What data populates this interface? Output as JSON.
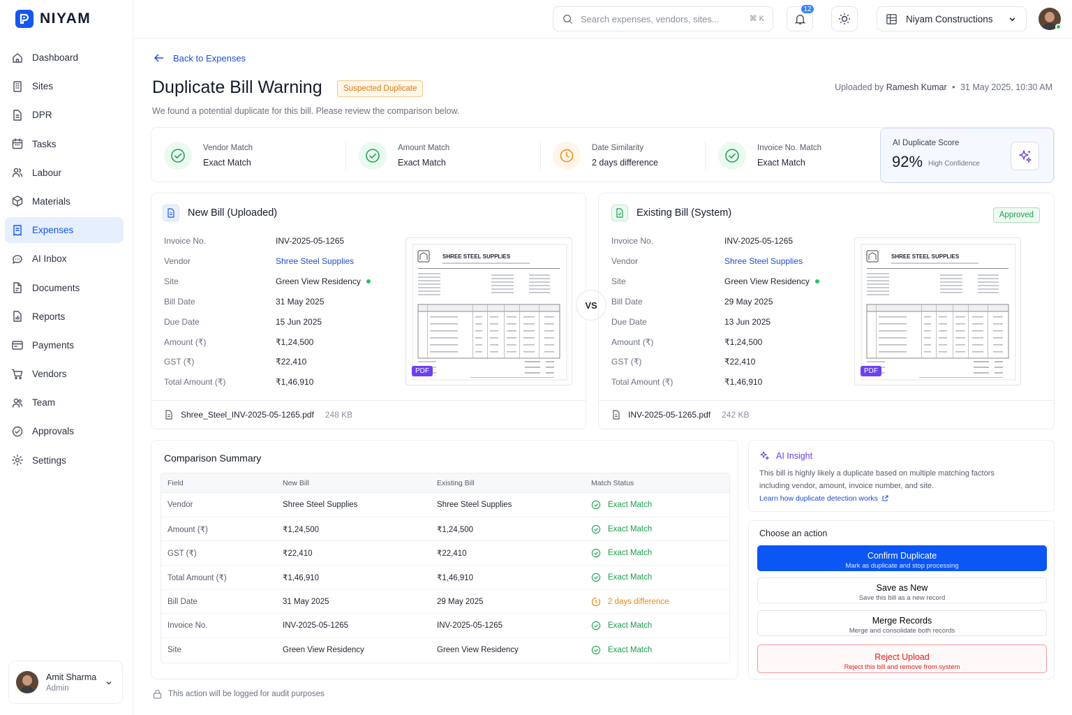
{
  "brand": {
    "name": "NIYAM"
  },
  "sidebar": {
    "items": [
      {
        "label": "Dashboard",
        "icon": "home-icon"
      },
      {
        "label": "Sites",
        "icon": "building-icon"
      },
      {
        "label": "DPR",
        "icon": "file-icon"
      },
      {
        "label": "Tasks",
        "icon": "calendar-icon"
      },
      {
        "label": "Labour",
        "icon": "users-icon"
      },
      {
        "label": "Materials",
        "icon": "box-icon"
      },
      {
        "label": "Expenses",
        "icon": "receipt-icon",
        "active": true
      },
      {
        "label": "AI Inbox",
        "icon": "chat-icon"
      },
      {
        "label": "Documents",
        "icon": "document-icon"
      },
      {
        "label": "Reports",
        "icon": "report-icon"
      },
      {
        "label": "Payments",
        "icon": "card-icon"
      },
      {
        "label": "Vendors",
        "icon": "cart-icon"
      },
      {
        "label": "Team",
        "icon": "team-icon"
      },
      {
        "label": "Approvals",
        "icon": "check-circle-icon"
      },
      {
        "label": "Settings",
        "icon": "gear-icon"
      }
    ],
    "user": {
      "name": "Amit Sharma",
      "role": "Admin"
    }
  },
  "topbar": {
    "search_placeholder": "Search expenses, vendors, sites...",
    "search_shortcut": "⌘ K",
    "notification_count": "12",
    "org_name": "Niyam Constructions"
  },
  "page": {
    "back_label": "Back to Expenses",
    "title": "Duplicate Bill Warning",
    "status_badge": "Suspected Duplicate",
    "subtitle": "We found a potential duplicate for this bill. Please review the comparison below.",
    "uploaded_prefix": "Uploaded by",
    "uploaded_by": "Ramesh Kumar",
    "uploaded_sep": "•",
    "uploaded_at": "31 May 2025, 10:30 AM"
  },
  "matches": [
    {
      "label": "Vendor Match",
      "value": "Exact Match",
      "status": "exact"
    },
    {
      "label": "Amount Match",
      "value": "Exact Match",
      "status": "exact"
    },
    {
      "label": "Date Similarity",
      "value": "2 days difference",
      "status": "warning"
    },
    {
      "label": "Invoice No. Match",
      "value": "Exact Match",
      "status": "exact"
    }
  ],
  "score": {
    "label": "AI Duplicate Score",
    "value": "92%",
    "confidence": "High Confidence"
  },
  "fields": [
    "Invoice No.",
    "Vendor",
    "Site",
    "Bill Date",
    "Due Date",
    "Amount (₹)",
    "GST (₹)",
    "Total Amount (₹)"
  ],
  "new_bill": {
    "title": "New Bill (Uploaded)",
    "values": [
      "INV-2025-05-1265",
      "Shree Steel Supplies",
      "Green View Residency",
      "31 May 2025",
      "15 Jun 2025",
      "₹1,24,500",
      "₹22,410",
      "₹1,46,910"
    ],
    "file_name": "Shree_Steel_INV-2025-05-1265.pdf",
    "file_size": "248 KB",
    "preview_company": "SHREE STEEL SUPPLIES",
    "pdf_tag": "PDF"
  },
  "existing_bill": {
    "title": "Existing Bill (System)",
    "badge": "Approved",
    "values": [
      "INV-2025-05-1265",
      "Shree Steel Supplies",
      "Green View Residency",
      "29 May 2025",
      "13 Jun 2025",
      "₹1,24,500",
      "₹22,410",
      "₹1,46,910"
    ],
    "file_name": "INV-2025-05-1265.pdf",
    "file_size": "242 KB",
    "preview_company": "SHREE STEEL SUPPLIES",
    "pdf_tag": "PDF"
  },
  "vs_label": "VS",
  "summary": {
    "title": "Comparison Summary",
    "headers": [
      "Field",
      "New Bill",
      "Existing Bill",
      "Match Status"
    ],
    "rows": [
      {
        "field": "Vendor",
        "new": "Shree Steel Supplies",
        "existing": "Shree Steel Supplies",
        "status": "Exact Match",
        "kind": "exact"
      },
      {
        "field": "Amount (₹)",
        "new": "₹1,24,500",
        "existing": "₹1,24,500",
        "status": "Exact Match",
        "kind": "exact"
      },
      {
        "field": "GST (₹)",
        "new": "₹22,410",
        "existing": "₹22,410",
        "status": "Exact Match",
        "kind": "exact"
      },
      {
        "field": "Total Amount (₹)",
        "new": "₹1,46,910",
        "existing": "₹1,46,910",
        "status": "Exact Match",
        "kind": "exact"
      },
      {
        "field": "Bill Date",
        "new": "31 May 2025",
        "existing": "29 May 2025",
        "status": "2 days difference",
        "kind": "warning"
      },
      {
        "field": "Invoice No.",
        "new": "INV-2025-05-1265",
        "existing": "INV-2025-05-1265",
        "status": "Exact Match",
        "kind": "exact"
      },
      {
        "field": "Site",
        "new": "Green View Residency",
        "existing": "Green View Residency",
        "status": "Exact Match",
        "kind": "exact"
      }
    ]
  },
  "audit_note": "This action will be logged for audit purposes",
  "insight": {
    "title": "AI Insight",
    "text": "This bill is highly likely a duplicate based on multiple matching factors including vendor, amount, invoice number, and site.",
    "link": "Learn how duplicate detection works"
  },
  "actions": {
    "title": "Choose an action",
    "confirm": {
      "label": "Confirm Duplicate",
      "desc": "Mark as duplicate and stop processing"
    },
    "save_new": {
      "label": "Save as New",
      "desc": "Save this bill as a new record"
    },
    "merge": {
      "label": "Merge Records",
      "desc": "Merge and consolidate both records"
    },
    "reject": {
      "label": "Reject Upload",
      "desc": "Reject this bill and remove from system"
    }
  },
  "colors": {
    "accent": "#1456f0",
    "success": "#19a04a",
    "warning": "#e88a10",
    "danger": "#e11d1d",
    "ai": "#6d3ff0"
  }
}
